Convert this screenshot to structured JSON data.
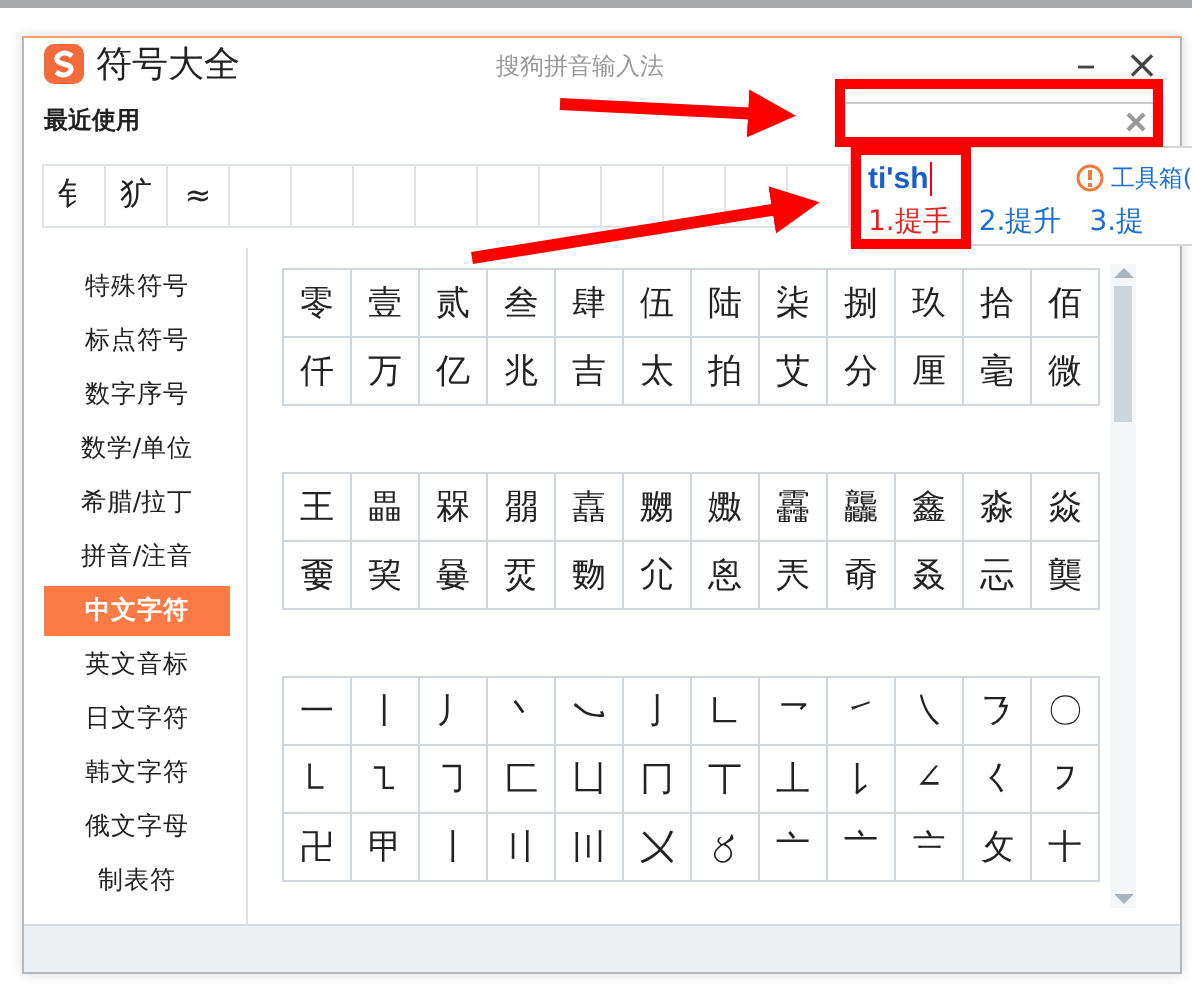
{
  "window": {
    "title": "符号大全",
    "subtitle": "搜狗拼音输入法",
    "minimize": "–",
    "close": "×"
  },
  "recent": {
    "label": "最近使用",
    "symbols": [
      "钅",
      "犷",
      "≈"
    ]
  },
  "categories": [
    {
      "label": "特殊符号",
      "selected": false
    },
    {
      "label": "标点符号",
      "selected": false
    },
    {
      "label": "数字序号",
      "selected": false
    },
    {
      "label": "数学/单位",
      "selected": false
    },
    {
      "label": "希腊/拉丁",
      "selected": false
    },
    {
      "label": "拼音/注音",
      "selected": false
    },
    {
      "label": "中文字符",
      "selected": true
    },
    {
      "label": "英文音标",
      "selected": false
    },
    {
      "label": "日文字符",
      "selected": false
    },
    {
      "label": "韩文字符",
      "selected": false
    },
    {
      "label": "俄文字母",
      "selected": false
    },
    {
      "label": "制表符",
      "selected": false
    }
  ],
  "symbol_groups": [
    [
      [
        "零",
        "壹",
        "贰",
        "叁",
        "肆",
        "伍",
        "陆",
        "柒",
        "捌",
        "玖",
        "拾",
        "佰"
      ],
      [
        "仟",
        "万",
        "亿",
        "兆",
        "吉",
        "太",
        "拍",
        "艾",
        "分",
        "厘",
        "毫",
        "微"
      ]
    ],
    [
      [
        "王",
        "畾",
        "槑",
        "朤",
        "嚞",
        "嬲",
        "嫐",
        "靐",
        "龘",
        "鑫",
        "淼",
        "焱"
      ],
      [
        "嫑",
        "巭",
        "嘦",
        "烎",
        "覅",
        "尣",
        "恖",
        "兲",
        "奣",
        "叒",
        "忈",
        "龑"
      ]
    ],
    [
      [
        "一",
        "丨",
        "丿",
        "丶",
        "㇃",
        "亅",
        "㇗",
        "㇖",
        "㇀",
        "㇏",
        "㇋",
        "〇"
      ],
      [
        "㇄",
        "㇅",
        "㇆",
        "匚",
        "凵",
        "冂",
        "丅",
        "丄",
        "㇙",
        "∠",
        "㇛",
        "㇇"
      ],
      [
        "卍",
        "甲",
        "〡",
        "〢",
        "〣",
        "〤",
        "〥",
        "亠",
        "〦",
        "〧",
        "攵",
        "〸"
      ]
    ]
  ],
  "ime": {
    "composition": "ti'sh",
    "toolbox": "工具箱(",
    "candidates": [
      {
        "label": "1.提手",
        "selected": true
      },
      {
        "label": "2.提升",
        "selected": false
      },
      {
        "label": "3.提",
        "selected": false
      }
    ]
  }
}
